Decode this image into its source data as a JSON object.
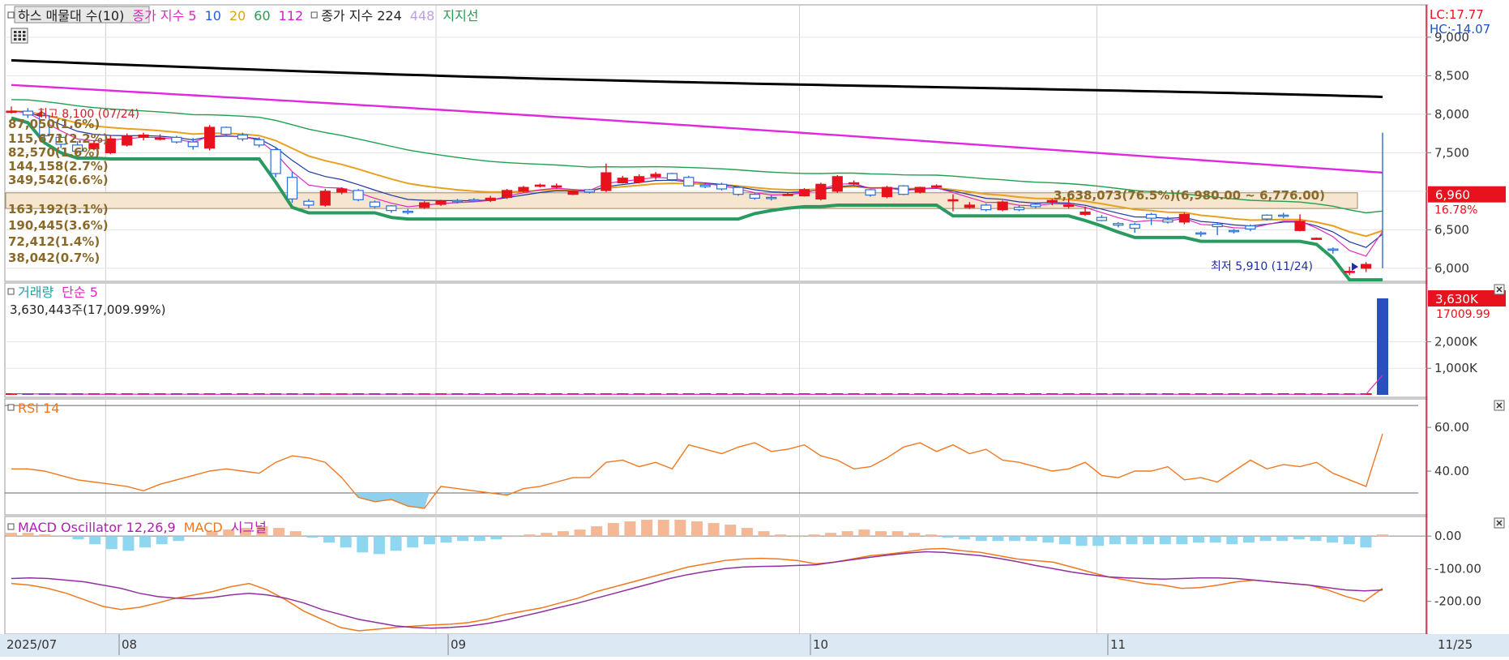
{
  "price_panel": {
    "legend": [
      {
        "text": "하스 매물대 수(10)",
        "color": "#222222"
      },
      {
        "text": "종가 지수 5",
        "color": "#e028c0"
      },
      {
        "text": "10",
        "color": "#2060d0"
      },
      {
        "text": "20",
        "color": "#e0a010"
      },
      {
        "text": "60",
        "color": "#20a050"
      },
      {
        "text": "112",
        "color": "#d020d0"
      },
      {
        "text": "종가 지수 224",
        "color": "#222222"
      },
      {
        "text": "448",
        "color": "#c0a0e0"
      },
      {
        "text": "지지선",
        "color": "#20a050"
      }
    ],
    "lc_text": "LC:17.77",
    "hc_text": "HC:-14.07",
    "high_label": "최고 8,100 (07/24)",
    "low_label": "최저 5,910 (11/24)",
    "current_price": "6,960",
    "current_change": "16.78%",
    "band_label": "3,638,073(76.5%)(6,980.00 ~ 6,776.00)",
    "volume_profile": [
      "87,050(1.6%)",
      "115,671(2.2%)",
      "82,570(1.6%)",
      "144,158(2.7%)",
      "349,542(6.6%)",
      "163,192(3.1%)",
      "190,445(3.6%)",
      "72,412(1.4%)",
      "38,042(0.7%)"
    ],
    "yticks": [
      "9,000",
      "8,500",
      "8,000",
      "7,500",
      "7,000",
      "6,500",
      "6,000"
    ]
  },
  "volume_panel": {
    "legend": [
      {
        "text": "거래량",
        "color": "#20a0a0"
      },
      {
        "text": "단순 5",
        "color": "#e028c0"
      }
    ],
    "value_text": "3,630,443주(17,009.99%)",
    "current_label": "3,630K",
    "current_pct": "17009.99",
    "yticks": [
      "2,000K",
      "1,000K"
    ]
  },
  "rsi_panel": {
    "legend": [
      {
        "text": "RSI 14",
        "color": "#f07820"
      }
    ],
    "yticks": [
      "60.00",
      "40.00"
    ]
  },
  "macd_panel": {
    "legend": [
      {
        "text": "MACD Oscillator 12,26,9",
        "color": "#b020b0"
      },
      {
        "text": "MACD",
        "color": "#f07820"
      },
      {
        "text": "시그널",
        "color": "#b020b0"
      }
    ],
    "yticks": [
      "0.00",
      "-100.00",
      "-200.00"
    ]
  },
  "date_axis": [
    "2025/07",
    "08",
    "09",
    "10",
    "11",
    "11/25"
  ],
  "colors": {
    "up": "#e8121e",
    "down": "#2a6ed8",
    "ma5": "#e028c0",
    "ma10": "#2038a0",
    "ma20": "#e8a020",
    "ma60": "#20a050",
    "ma112": "#e028e0",
    "ma224": "#000000",
    "support": "#2a9a60",
    "rsi": "#f07820",
    "macd": "#f07820",
    "signal": "#9030a0"
  },
  "chart_data": [
    {
      "type": "candlestick",
      "title": "하스",
      "x": [
        "07/24",
        "07/25",
        "07/28",
        "07/29",
        "07/30",
        "07/31",
        "08/01",
        "08/04",
        "08/05",
        "08/06",
        "08/07",
        "08/08",
        "08/11",
        "08/12",
        "08/13",
        "08/14",
        "08/18",
        "08/19",
        "08/20",
        "08/21",
        "08/22",
        "08/25",
        "08/26",
        "08/27",
        "08/28",
        "08/29",
        "09/01",
        "09/02",
        "09/03",
        "09/04",
        "09/05",
        "09/08",
        "09/09",
        "09/10",
        "09/11",
        "09/12",
        "09/15",
        "09/16",
        "09/17",
        "09/18",
        "09/19",
        "09/22",
        "09/23",
        "09/24",
        "09/25",
        "09/26",
        "09/29",
        "09/30",
        "10/01",
        "10/02",
        "10/10",
        "10/13",
        "10/14",
        "10/15",
        "10/16",
        "10/17",
        "10/20",
        "10/21",
        "10/22",
        "10/23",
        "10/24",
        "10/27",
        "10/28",
        "10/29",
        "10/30",
        "10/31",
        "11/03",
        "11/04",
        "11/05",
        "11/06",
        "11/07",
        "11/10",
        "11/11",
        "11/12",
        "11/13",
        "11/14",
        "11/17",
        "11/18",
        "11/19",
        "11/20",
        "11/21",
        "11/24",
        "11/25"
      ],
      "open": [
        8030,
        8040,
        7980,
        7700,
        7600,
        7550,
        7500,
        7600,
        7700,
        7690,
        7700,
        7640,
        7560,
        7830,
        7730,
        7670,
        7540,
        7180,
        6870,
        6820,
        6990,
        7010,
        6860,
        6810,
        6740,
        6790,
        6830,
        6880,
        6890,
        6880,
        6920,
        7000,
        7070,
        7070,
        6960,
        7020,
        7010,
        7110,
        7120,
        7190,
        7230,
        7180,
        7080,
        7090,
        7050,
        6960,
        6920,
        6960,
        6940,
        6900,
        7000,
        7100,
        7020,
        6930,
        7070,
        6990,
        7060,
        6880,
        6790,
        6820,
        6760,
        6790,
        6830,
        6870,
        6820,
        6700,
        6660,
        6580,
        6570,
        6700,
        6630,
        6600,
        6460,
        6570,
        6490,
        6550,
        6690,
        6690,
        6490,
        6380,
        6250,
        5960,
        6000
      ],
      "close": [
        8040,
        7990,
        7720,
        7610,
        7520,
        7620,
        7680,
        7710,
        7730,
        7690,
        7640,
        7580,
        7830,
        7740,
        7680,
        7600,
        7230,
        6900,
        6820,
        7000,
        7030,
        6890,
        6800,
        6750,
        6730,
        6850,
        6870,
        6870,
        6880,
        6910,
        7010,
        7050,
        7080,
        7070,
        7000,
        6990,
        7240,
        7170,
        7190,
        7220,
        7150,
        7070,
        7060,
        7030,
        6960,
        6910,
        6910,
        6960,
        7020,
        7090,
        7190,
        7110,
        6950,
        7050,
        6960,
        7050,
        7070,
        6890,
        6820,
        6760,
        6860,
        6760,
        6800,
        6880,
        6820,
        6730,
        6620,
        6560,
        6520,
        6650,
        6600,
        6700,
        6450,
        6540,
        6480,
        6510,
        6640,
        6680,
        6610,
        6390,
        6240,
        5960,
        6050,
        6960
      ],
      "high": [
        8100,
        8080,
        8020,
        7740,
        7650,
        7660,
        7720,
        7750,
        7760,
        7740,
        7720,
        7690,
        7860,
        7840,
        7760,
        7700,
        7560,
        7250,
        6900,
        7030,
        7050,
        7030,
        6880,
        6820,
        6770,
        6870,
        6890,
        6900,
        6910,
        6940,
        7030,
        7070,
        7100,
        7100,
        7010,
        7030,
        7360,
        7200,
        7220,
        7250,
        7240,
        7200,
        7100,
        7110,
        7070,
        6980,
        6950,
        6980,
        7040,
        7110,
        7210,
        7140,
        7030,
        7070,
        7080,
        7060,
        7090,
        6960,
        6860,
        6840,
        6880,
        6820,
        6840,
        6900,
        6960,
        6800,
        6690,
        6600,
        6590,
        6720,
        6670,
        6720,
        6480,
        6590,
        6510,
        6570,
        6700,
        6720,
        6700,
        6400,
        6270,
        6020,
        6080,
        7760
      ],
      "low": [
        8010,
        7950,
        7690,
        7560,
        7490,
        7530,
        7480,
        7580,
        7660,
        7660,
        7620,
        7540,
        7530,
        7710,
        7650,
        7570,
        7180,
        6850,
        6780,
        6800,
        6960,
        6870,
        6780,
        6720,
        6700,
        6770,
        6810,
        6840,
        6860,
        6860,
        6900,
        6980,
        7050,
        7030,
        6950,
        6970,
        6990,
        7100,
        7100,
        7150,
        7130,
        7060,
        7040,
        7010,
        6940,
        6890,
        6880,
        6940,
        6930,
        6880,
        6980,
        7080,
        6930,
        6910,
        6950,
        6970,
        7040,
        6740,
        6770,
        6740,
        6740,
        6740,
        6780,
        6820,
        6780,
        6680,
        6610,
        6530,
        6460,
        6560,
        6580,
        6570,
        6410,
        6430,
        6450,
        6480,
        6620,
        6650,
        6480,
        6370,
        6190,
        5910,
        5950,
        6000
      ]
    },
    {
      "type": "bar",
      "title": "거래량",
      "values": [
        45000,
        30000,
        25000,
        22000,
        18000,
        20000,
        25000,
        30000,
        28000,
        22000,
        20000,
        18000,
        25000,
        22000,
        20000,
        18000,
        32000,
        28000,
        24000,
        26000,
        22000,
        20000,
        24000,
        30000,
        28000,
        22000,
        20000,
        18000,
        16000,
        18000,
        20000,
        22000,
        24000,
        20000,
        18000,
        16000,
        38000,
        22000,
        20000,
        18000,
        16000,
        14000,
        16000,
        18000,
        20000,
        18000,
        16000,
        18000,
        16000,
        20000,
        22000,
        20000,
        24000,
        18000,
        16000,
        14000,
        18000,
        20000,
        16000,
        14000,
        18000,
        16000,
        14000,
        22000,
        24000,
        28000,
        26000,
        24000,
        28000,
        22000,
        20000,
        18000,
        24000,
        22000,
        20000,
        18000,
        22000,
        20000,
        24000,
        26000,
        22000,
        28000,
        20000,
        3630443
      ],
      "ylim": [
        0,
        3630000
      ]
    },
    {
      "type": "line",
      "title": "RSI 14",
      "values": [
        41,
        41,
        40,
        38,
        36,
        35,
        34,
        33,
        31,
        34,
        36,
        38,
        40,
        41,
        40,
        39,
        44,
        47,
        46,
        44,
        37,
        28,
        26,
        27,
        24,
        23,
        33,
        32,
        31,
        30,
        29,
        32,
        33,
        35,
        37,
        37,
        44,
        45,
        42,
        44,
        41,
        52,
        50,
        48,
        51,
        53,
        49,
        50,
        52,
        47,
        45,
        41,
        42,
        46,
        51,
        53,
        49,
        52,
        48,
        50,
        45,
        44,
        42,
        40,
        41,
        44,
        38,
        37,
        40,
        40,
        42,
        36,
        37,
        35,
        40,
        45,
        41,
        43,
        42,
        44,
        39,
        36,
        33,
        57
      ],
      "yticks": [
        40,
        60
      ]
    },
    {
      "type": "line",
      "title": "MACD Oscillator 12,26,9",
      "series": [
        {
          "name": "MACD",
          "values": [
            -145,
            -150,
            -160,
            -175,
            -195,
            -215,
            -225,
            -218,
            -205,
            -190,
            -180,
            -170,
            -155,
            -145,
            -165,
            -195,
            -230,
            -255,
            -280,
            -290,
            -285,
            -280,
            -276,
            -272,
            -270,
            -265,
            -255,
            -240,
            -230,
            -220,
            -205,
            -190,
            -170,
            -155,
            -140,
            -125,
            -110,
            -95,
            -85,
            -75,
            -70,
            -68,
            -70,
            -75,
            -85,
            -80,
            -70,
            -60,
            -55,
            -48,
            -40,
            -38,
            -45,
            -50,
            -60,
            -70,
            -75,
            -80,
            -95,
            -110,
            -125,
            -135,
            -145,
            -150,
            -160,
            -158,
            -150,
            -140,
            -135,
            -140,
            -145,
            -150,
            -165,
            -185,
            -200,
            -160
          ]
        },
        {
          "name": "시그널",
          "values": [
            -130,
            -128,
            -130,
            -135,
            -140,
            -150,
            -160,
            -175,
            -185,
            -190,
            -192,
            -188,
            -180,
            -175,
            -180,
            -190,
            -205,
            -225,
            -240,
            -255,
            -265,
            -275,
            -280,
            -282,
            -280,
            -276,
            -268,
            -258,
            -245,
            -232,
            -218,
            -205,
            -190,
            -175,
            -160,
            -145,
            -130,
            -118,
            -108,
            -100,
            -95,
            -93,
            -92,
            -90,
            -88,
            -80,
            -72,
            -65,
            -58,
            -52,
            -48,
            -50,
            -55,
            -60,
            -68,
            -78,
            -90,
            -100,
            -110,
            -118,
            -125,
            -128,
            -130,
            -132,
            -130,
            -128,
            -128,
            -130,
            -135,
            -140,
            -145,
            -150,
            -158,
            -165,
            -168,
            -165
          ]
        },
        {
          "name": "MACD Oscillator",
          "values": [
            10,
            10,
            5,
            0,
            -10,
            -25,
            -40,
            -45,
            -35,
            -25,
            -15,
            0,
            15,
            20,
            25,
            30,
            25,
            15,
            -5,
            -20,
            -35,
            -50,
            -55,
            -45,
            -35,
            -25,
            -20,
            -15,
            -15,
            -10,
            0,
            5,
            10,
            15,
            20,
            30,
            40,
            45,
            50,
            50,
            50,
            45,
            40,
            35,
            25,
            15,
            5,
            0,
            5,
            10,
            15,
            20,
            15,
            15,
            10,
            5,
            -5,
            -10,
            -15,
            -15,
            -15,
            -15,
            -20,
            -25,
            -30,
            -30,
            -25,
            -25,
            -25,
            -25,
            -25,
            -20,
            -20,
            -25,
            -20,
            -15,
            -15,
            -10,
            -15,
            -20,
            -25,
            -35,
            5
          ]
        }
      ],
      "yticks": [
        0,
        -100,
        -200
      ]
    }
  ]
}
